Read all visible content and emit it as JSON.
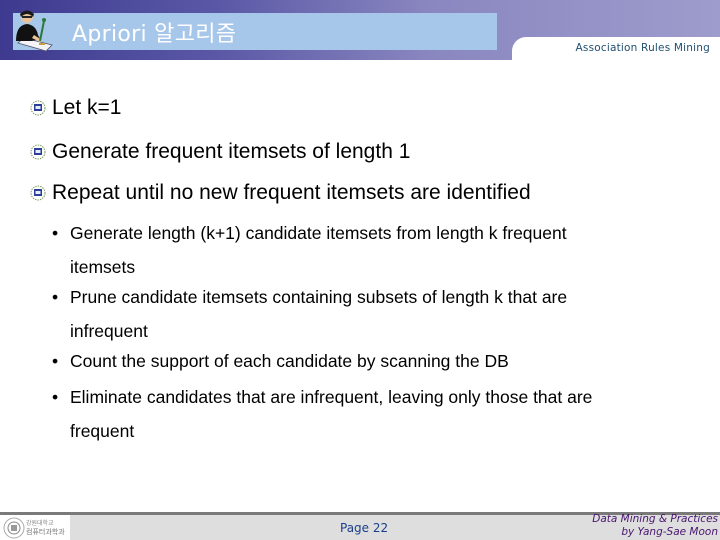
{
  "header": {
    "title": "Apriori 알고리즘",
    "section": "Association Rules Mining",
    "logo_icon": "person-writing-icon",
    "colors": {
      "band_dark": "#3d3a8f",
      "band_light": "#9e9ccc",
      "title_bar": "#a6c6ea"
    }
  },
  "content": {
    "bullet_icon": "decorative-bullet-icon",
    "items": [
      {
        "text": "Let k=1"
      },
      {
        "text": "Generate frequent itemsets of length 1"
      },
      {
        "text": "Repeat until no new frequent itemsets are identified"
      }
    ],
    "subitems": [
      {
        "line1": "Generate length (k+1) candidate itemsets from length k frequent",
        "line2": "itemsets"
      },
      {
        "line1": "Prune candidate itemsets containing subsets of length k that are",
        "line2": "infrequent"
      },
      {
        "line1": "Count the support of each candidate by scanning the DB",
        "line2": ""
      },
      {
        "line1": "Eliminate candidates that are infrequent, leaving only those that are",
        "line2": "frequent"
      }
    ],
    "sub_bullet": "•"
  },
  "footer": {
    "logo_icon": "university-seal-icon",
    "logo_text_1": "강원대학교",
    "logo_text_2": "컴퓨터과학과",
    "page": "Page 22",
    "credit_line1": "Data Mining & Practices",
    "credit_line2": "by Yang-Sae Moon"
  }
}
